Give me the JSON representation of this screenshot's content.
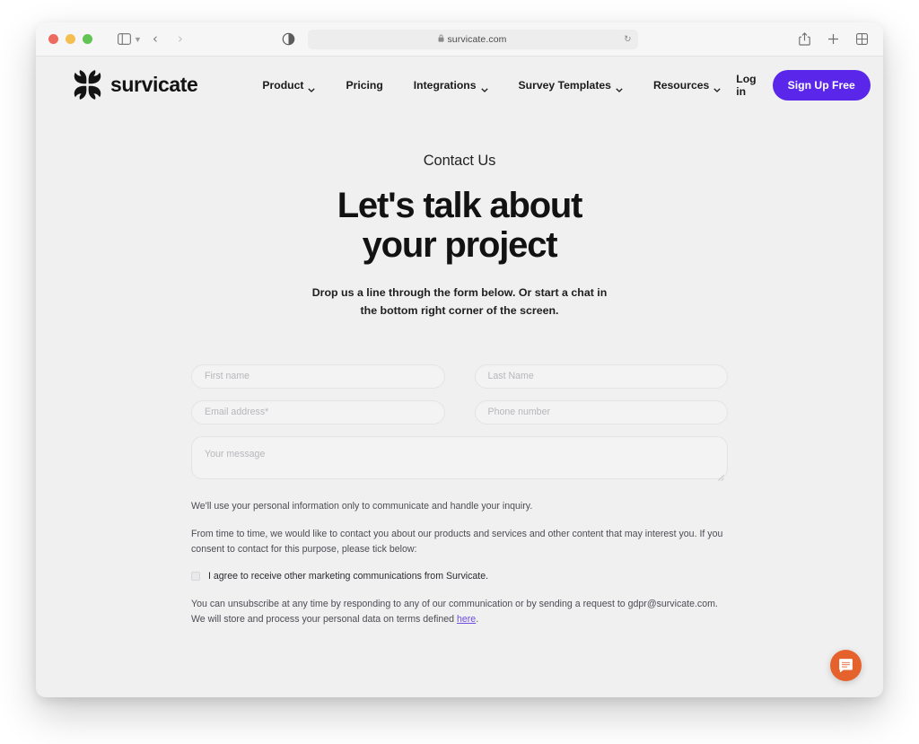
{
  "browser": {
    "traffic_lights": [
      "close",
      "minimize",
      "maximize"
    ],
    "sidebar_toggle_label": "sidebar-toggle",
    "back_label": "‹",
    "forward_label": "›",
    "lock_glyph": "🔒",
    "url": "survicate.com",
    "reload_glyph": "↻",
    "share_label": "share",
    "new_tab_label": "+",
    "tab_overview_label": "tab-overview"
  },
  "site": {
    "brand_name": "survicate",
    "nav": [
      {
        "label": "Product",
        "has_caret": true
      },
      {
        "label": "Pricing",
        "has_caret": false
      },
      {
        "label": "Integrations",
        "has_caret": true
      },
      {
        "label": "Survey Templates",
        "has_caret": true
      },
      {
        "label": "Resources",
        "has_caret": true
      }
    ],
    "login_label": "Log in",
    "signup_label": "Sign Up Free"
  },
  "hero": {
    "eyebrow": "Contact Us",
    "title_line1": "Let's talk about",
    "title_line2": "your project",
    "subtitle_line1": "Drop us a line through the form below. Or start a chat in",
    "subtitle_line2": "the bottom right corner of the screen."
  },
  "form": {
    "first_name_placeholder": "First name",
    "last_name_placeholder": "Last Name",
    "email_placeholder": "Email address*",
    "phone_placeholder": "Phone number",
    "message_placeholder": "Your message",
    "first_name_value": "",
    "last_name_value": "",
    "email_value": "",
    "phone_value": "",
    "message_value": ""
  },
  "legal": {
    "paragraph1": "We'll use your personal information only to communicate and handle your inquiry.",
    "paragraph2": "From time to time, we would like to contact you about our products and services and other content that may interest you. If you consent to contact for this purpose, please tick below:",
    "consent_label": "I agree to receive other marketing communications from Survicate.",
    "consent_checked": false,
    "paragraph3_part1": "You can unsubscribe at any time by responding to any of our communication or by sending a request to gdpr@survicate.com. We will store and process your personal data on terms defined ",
    "paragraph3_link": "here",
    "paragraph3_part2": "."
  },
  "chat": {
    "launcher_label": "open-chat"
  },
  "colors": {
    "brand_purple": "#5a27ea",
    "link_purple": "#6c4de0",
    "chat_orange": "#e6622c",
    "page_background": "#f0f0f0",
    "chrome_background": "#f6f6f6",
    "heading_text": "#121212"
  }
}
